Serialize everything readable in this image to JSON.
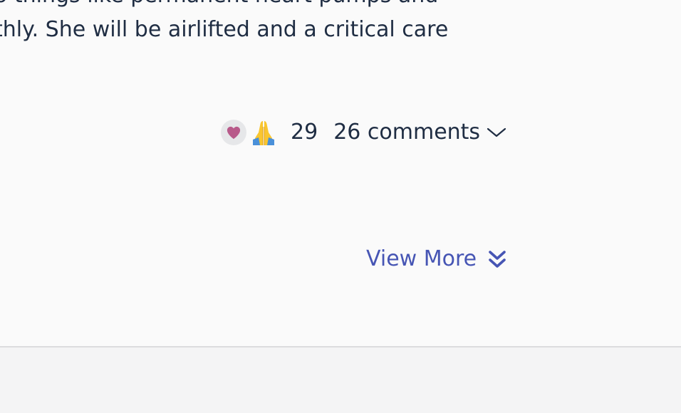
{
  "post": {
    "text_lines": [
      "o things like permanent heart pumps and",
      "thly. She will be airlifted and a critical care"
    ]
  },
  "reactions": {
    "icons": [
      "heart-icon",
      "praying-hands-icon"
    ],
    "count": "29"
  },
  "comments": {
    "label": "26 comments"
  },
  "view_more": {
    "label": "View More"
  },
  "colors": {
    "text": "#1f2d43",
    "link": "#4655b4",
    "heart": "#b85a8a",
    "card_background": "#fafafa",
    "page_background": "#f4f4f5",
    "divider": "#dcdcde"
  }
}
